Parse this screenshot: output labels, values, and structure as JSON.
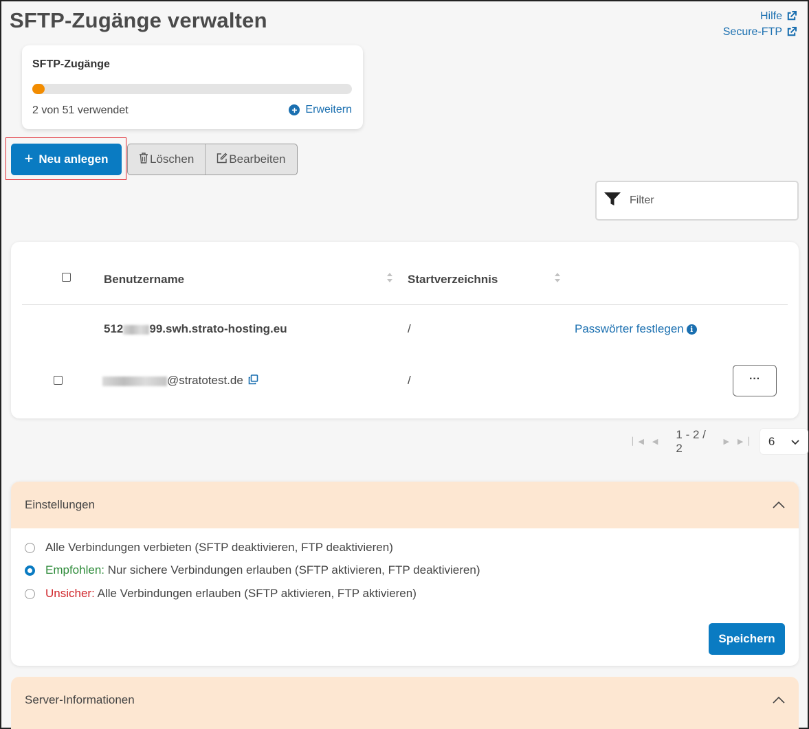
{
  "page": {
    "title": "SFTP-Zugänge verwalten"
  },
  "links": [
    {
      "label": "Hilfe",
      "icon": "external-link-icon"
    },
    {
      "label": "Secure-FTP",
      "icon": "external-link-icon"
    }
  ],
  "quota": {
    "title": "SFTP-Zugänge",
    "used": 2,
    "total": 51,
    "fill_fraction": 0.039,
    "text": "2 von 51 verwendet",
    "expand_label": "Erweitern"
  },
  "toolbar": {
    "new_label": "Neu anlegen",
    "delete_label": "Löschen",
    "edit_label": "Bearbeiten"
  },
  "filter": {
    "placeholder": "Filter"
  },
  "table": {
    "columns": [
      "Benutzername",
      "Startverzeichnis"
    ],
    "rows": [
      {
        "user_prefix": "512",
        "user_suffix": "99.swh.strato-hosting.eu",
        "dir": "/",
        "action": "Passwörter festlegen"
      },
      {
        "user_suffix": "@stratotest.de",
        "dir": "/",
        "more": "···"
      }
    ]
  },
  "pager": {
    "range": "1 - 2 / 2",
    "page_size": "6"
  },
  "settings": {
    "title": "Einstellungen",
    "options": [
      {
        "prefix": "",
        "text": "Alle Verbindungen verbieten (SFTP deaktivieren, FTP deaktivieren)",
        "selected": false
      },
      {
        "prefix": "Empfohlen:",
        "text": " Nur sichere Verbindungen erlauben (SFTP aktivieren, FTP deaktivieren)",
        "selected": true
      },
      {
        "prefix": "Unsicher:",
        "text": " Alle Verbindungen erlauben (SFTP aktivieren, FTP aktivieren)",
        "selected": false
      }
    ],
    "save_label": "Speichern"
  },
  "server": {
    "title": "Server-Informationen"
  },
  "colors": {
    "primary": "#0a7bc2",
    "accent_orange": "#f28c00",
    "section_header": "#fde7d2",
    "recommended": "#2e8b3a",
    "unsafe": "#d0262b"
  }
}
